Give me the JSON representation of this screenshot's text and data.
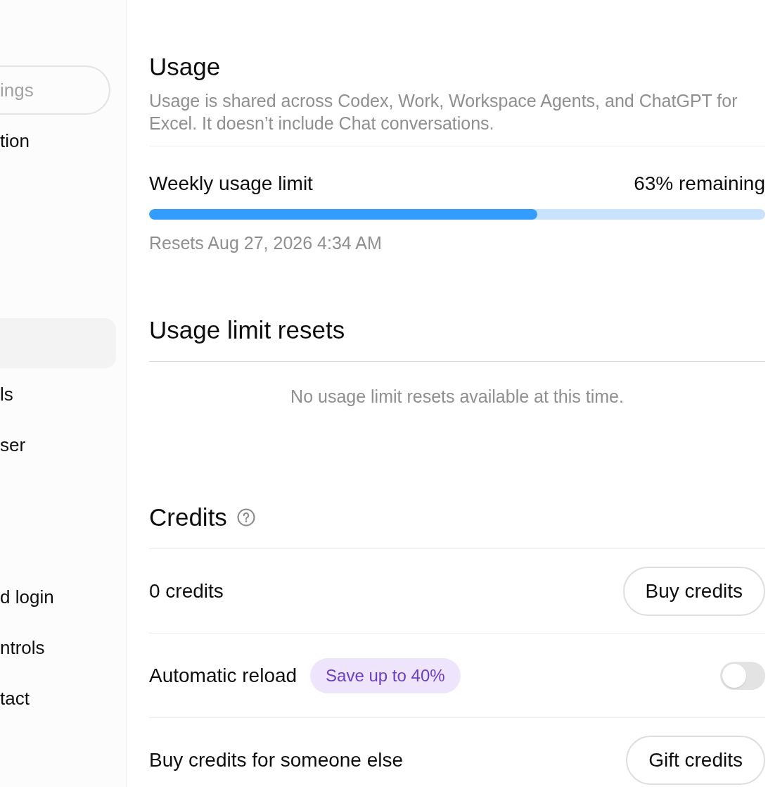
{
  "sidebar": {
    "search": {
      "placeholder": "ings"
    },
    "items": [
      {
        "label": "tion",
        "selected": false
      },
      {
        "selected": true
      },
      {
        "label": "ls",
        "selected": false
      },
      {
        "label": "ser",
        "selected": false
      },
      {
        "label": "d login",
        "selected": false
      },
      {
        "label": "ntrols",
        "selected": false
      },
      {
        "label": "tact",
        "selected": false
      }
    ]
  },
  "usage": {
    "title": "Usage",
    "description": "Usage is shared across Codex, Work, Workspace Agents, and ChatGPT for Excel. It doesn’t include Chat conversations.",
    "limit": {
      "label": "Weekly usage limit",
      "reading": "63% remaining",
      "level": 0.63,
      "note": "Resets Aug 27, 2026 4:34 AM"
    }
  },
  "limit_resets": {
    "title": "Usage limit resets",
    "empty_message": "No usage limit resets available at this time."
  },
  "credits": {
    "title": "Credits",
    "rows": [
      {
        "kind": "button",
        "label": "0 credits",
        "button": "Buy credits"
      },
      {
        "kind": "toggle",
        "label": "Automatic reload",
        "badge": "Save up to 40%",
        "on": false
      },
      {
        "kind": "button",
        "label": "Buy credits for someone else",
        "button": "Gift credits"
      }
    ]
  }
}
